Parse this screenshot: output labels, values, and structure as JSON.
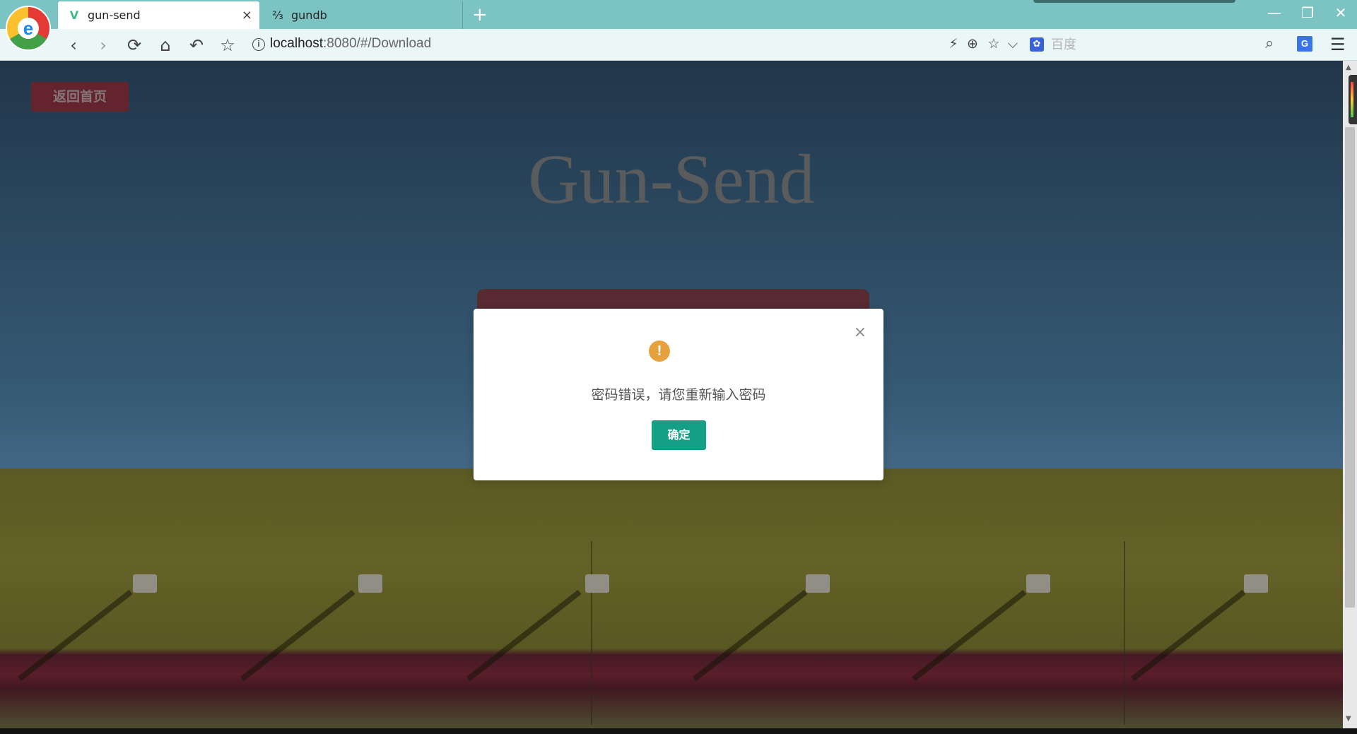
{
  "browser": {
    "tabs": [
      {
        "label": "gun-send",
        "active": true,
        "icon": "vue-logo-icon"
      },
      {
        "label": "gundb",
        "active": false,
        "icon": "gundb-favicon-icon"
      }
    ],
    "new_tab_symbol": "+",
    "window_controls": {
      "minimize": "—",
      "restore": "❐",
      "close": "✕"
    },
    "nav": {
      "back": "‹",
      "forward": "›",
      "reload": "⟳",
      "home": "⌂",
      "undo": "↶",
      "bookmark": "☆"
    },
    "url": {
      "host": "localhost",
      "rest": ":8080/#/Download"
    },
    "toolbar_icons": {
      "bolt": "⚡",
      "zoom": "⊕",
      "star": "☆",
      "dropdown": "⌵"
    },
    "search": {
      "placeholder": "百度",
      "engine_icon": "baidu-paw-icon"
    },
    "translate_label": "G",
    "menu_symbol": "☰"
  },
  "page": {
    "back_button": "返回首页",
    "title": "Gun-Send"
  },
  "modal": {
    "icon": "!",
    "message": "密码错误，请您重新输入密码",
    "confirm_button": "确定",
    "close_symbol": "×"
  },
  "colors": {
    "tab_bar": "#7cc3c3",
    "accent_green": "#13a085",
    "warning": "#e6a23c",
    "back_button": "#8b3340"
  }
}
